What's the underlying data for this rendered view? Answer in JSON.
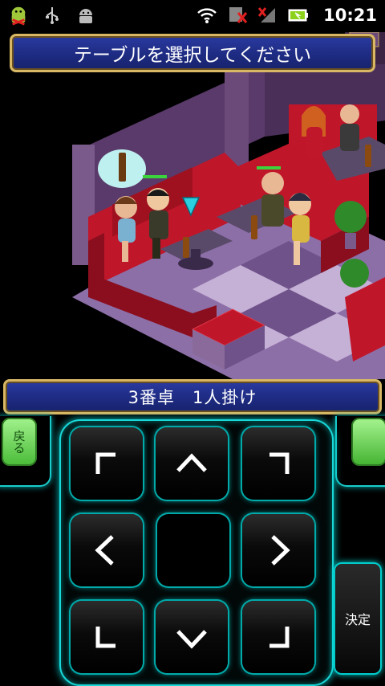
{
  "status_bar": {
    "time": "10:21",
    "icons": [
      "android-icon",
      "usb-icon",
      "android-debug-icon",
      "wifi-icon",
      "no-data-icon",
      "signal-icon",
      "battery-icon"
    ]
  },
  "title_banner": {
    "text": "テーブルを選択してください"
  },
  "info_banner": {
    "text": "3番卓　1人掛け"
  },
  "controls": {
    "back_label": "戻る",
    "ok_label": "決定"
  },
  "colors": {
    "banner_blue": "#1d2a80",
    "banner_border": "#d8b865",
    "neon_cyan": "#1bd8d8",
    "button_green": "#4cbd3b",
    "sofa_red": "#c0162a",
    "floor_purple": "#8d6fa8"
  }
}
